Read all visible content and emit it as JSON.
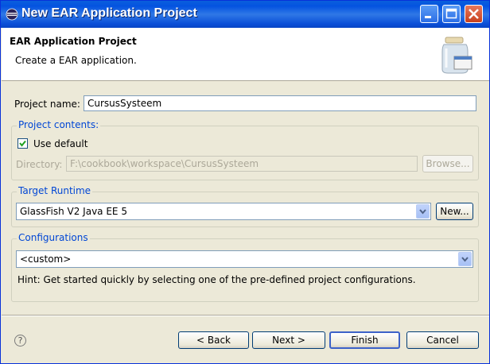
{
  "window": {
    "title": "New EAR Application Project"
  },
  "banner": {
    "title": "EAR Application Project",
    "description": "Create a EAR application."
  },
  "project_name": {
    "label": "Project name:",
    "value": "CursusSysteem"
  },
  "project_contents": {
    "legend": "Project contents:",
    "use_default_label": "Use default",
    "use_default_checked": true,
    "directory_label": "Directory:",
    "directory_value": "F:\\cookbook\\workspace\\CursusSysteem",
    "browse_label": "Browse..."
  },
  "target_runtime": {
    "legend": "Target Runtime",
    "selected": "GlassFish V2 Java EE 5",
    "new_label": "New..."
  },
  "configurations": {
    "legend": "Configurations",
    "selected": "<custom>",
    "hint": "Hint: Get started quickly by selecting one of the pre-defined project configurations."
  },
  "footer": {
    "back_label": "< Back",
    "next_label": "Next >",
    "finish_label": "Finish",
    "cancel_label": "Cancel"
  },
  "icons": {
    "window": "eclipse-icon",
    "banner": "jar-icon",
    "help": "help-icon"
  },
  "colors": {
    "titlebar": "#0453e0",
    "group_label": "#0046d5",
    "dialog_bg": "#ece9d8"
  }
}
